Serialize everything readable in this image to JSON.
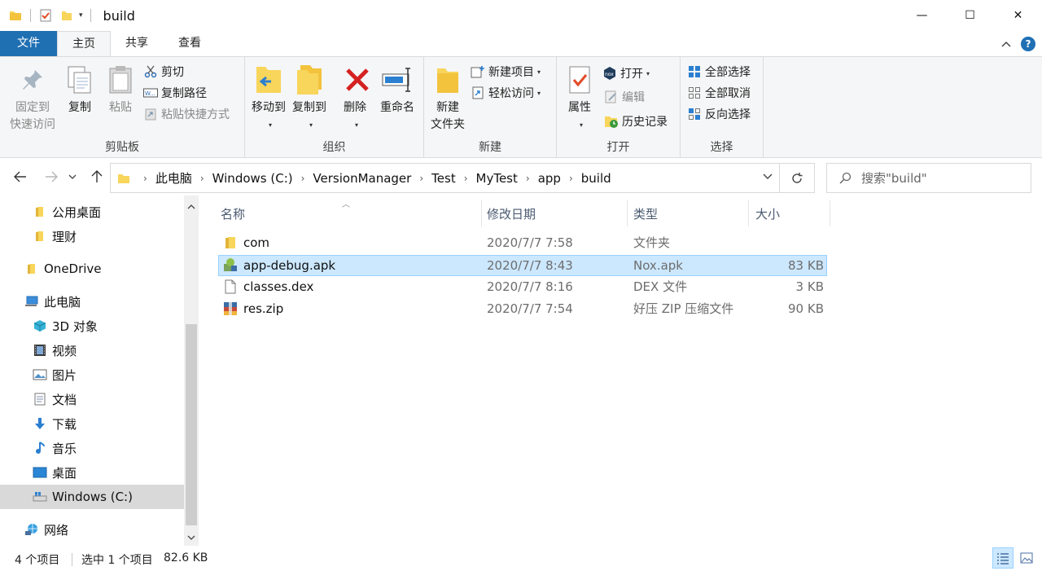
{
  "window": {
    "title": "build",
    "controls": {
      "minimize": "—",
      "maximize": "☐",
      "close": "✕"
    }
  },
  "ribbon_tabs": [
    {
      "label": "文件"
    },
    {
      "label": "主页"
    },
    {
      "label": "共享"
    },
    {
      "label": "查看"
    }
  ],
  "ribbon": {
    "clipboard": {
      "title": "剪贴板",
      "pin_line1": "固定到",
      "pin_line2": "快速访问",
      "copy": "复制",
      "paste": "粘贴",
      "cut": "剪切",
      "copy_path": "复制路径",
      "paste_shortcut": "粘贴快捷方式"
    },
    "organize": {
      "title": "组织",
      "move_to": "移动到",
      "copy_to": "复制到",
      "delete": "删除",
      "rename": "重命名"
    },
    "new": {
      "title": "新建",
      "new_folder_line1": "新建",
      "new_folder_line2": "文件夹",
      "new_item": "新建项目",
      "easy_access": "轻松访问"
    },
    "open": {
      "title": "打开",
      "properties": "属性",
      "open": "打开",
      "edit": "编辑",
      "history": "历史记录"
    },
    "select": {
      "title": "选择",
      "select_all": "全部选择",
      "select_none": "全部取消",
      "invert": "反向选择"
    }
  },
  "address": {
    "breadcrumbs": [
      "此电脑",
      "Windows (C:)",
      "VersionManager",
      "Test",
      "MyTest",
      "app",
      "build"
    ]
  },
  "search": {
    "placeholder": "搜索\"build\""
  },
  "nav_items": [
    {
      "label": "公用桌面",
      "icon": "folder-icon"
    },
    {
      "label": "理财",
      "icon": "folder-icon"
    },
    {
      "label": "OneDrive",
      "icon": "folder-icon"
    },
    {
      "label": "此电脑",
      "icon": "computer-icon"
    },
    {
      "label": "3D 对象",
      "icon": "cube-icon"
    },
    {
      "label": "视频",
      "icon": "film-icon"
    },
    {
      "label": "图片",
      "icon": "picture-icon"
    },
    {
      "label": "文档",
      "icon": "document-icon"
    },
    {
      "label": "下载",
      "icon": "download-icon"
    },
    {
      "label": "音乐",
      "icon": "music-icon"
    },
    {
      "label": "桌面",
      "icon": "desktop-icon"
    },
    {
      "label": "Windows (C:)",
      "icon": "drive-icon"
    },
    {
      "label": "网络",
      "icon": "network-icon"
    }
  ],
  "columns": {
    "name": "名称",
    "modified": "修改日期",
    "type": "类型",
    "size": "大小"
  },
  "files": [
    {
      "name": "com",
      "modified": "2020/7/7 7:58",
      "type": "文件夹",
      "size": "",
      "icon": "folder-icon"
    },
    {
      "name": "app-debug.apk",
      "modified": "2020/7/7 8:43",
      "type": "Nox.apk",
      "size": "83 KB",
      "icon": "apk-icon",
      "selected": true
    },
    {
      "name": "classes.dex",
      "modified": "2020/7/7 8:16",
      "type": "DEX 文件",
      "size": "3 KB",
      "icon": "file-icon"
    },
    {
      "name": "res.zip",
      "modified": "2020/7/7 7:54",
      "type": "好压 ZIP 压缩文件",
      "size": "90 KB",
      "icon": "zip-icon"
    }
  ],
  "status": {
    "item_count": "4 个项目",
    "selection": "选中 1 个项目",
    "selection_size": "82.6 KB"
  },
  "colors": {
    "accent": "#1f6fb3",
    "selected_row": "#cce8ff",
    "folder_yellow": "#f8d55b"
  }
}
